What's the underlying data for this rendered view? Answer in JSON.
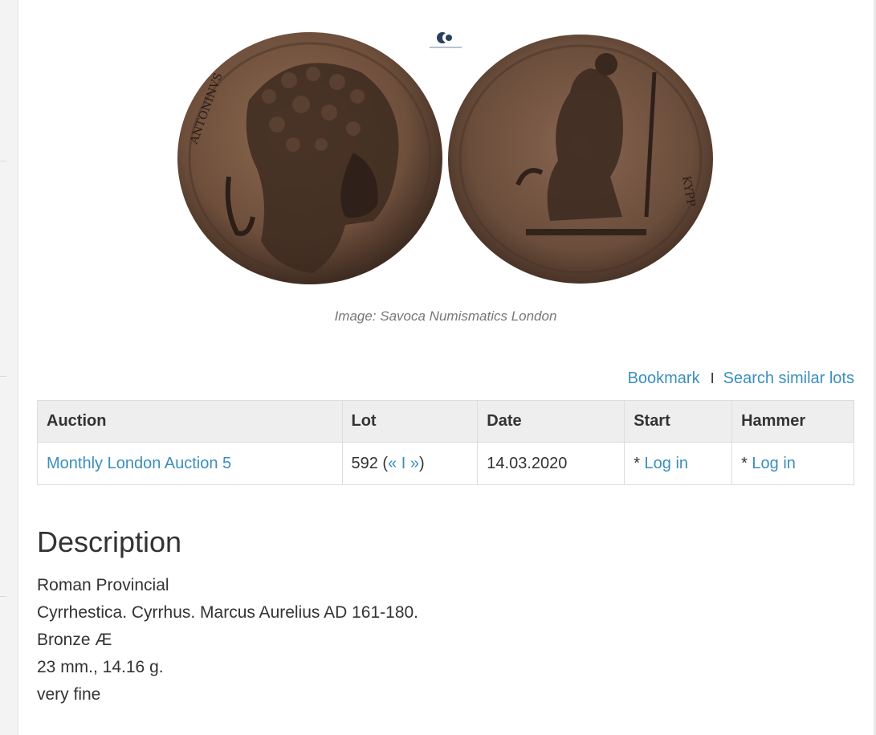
{
  "image": {
    "caption": "Image: Savoca Numismatics London",
    "coin_color": "#7a5a44",
    "watermark_logo": "SC"
  },
  "actions": {
    "bookmark_label": "Bookmark",
    "separator": "I",
    "search_similar_label": "Search similar lots"
  },
  "table": {
    "headers": [
      "Auction",
      "Lot",
      "Date",
      "Start",
      "Hammer"
    ],
    "row": {
      "auction": "Monthly London Auction 5",
      "lot_number": "592 (",
      "lot_prev": "«",
      "lot_sep": " I ",
      "lot_next": "»",
      "lot_close": ")",
      "date": "14.03.2020",
      "start_prefix": "* ",
      "start_link": "Log in",
      "hammer_prefix": "* ",
      "hammer_link": "Log in"
    }
  },
  "description": {
    "title": "Description",
    "lines": [
      "Roman Provincial",
      "Cyrrhestica. Cyrrhus. Marcus Aurelius AD 161-180.",
      "Bronze Æ",
      "23 mm., 14.16 g.",
      "very fine"
    ]
  },
  "colors": {
    "link": "#3a8fc0",
    "text": "#333333",
    "header_bg": "#eeeeee"
  }
}
